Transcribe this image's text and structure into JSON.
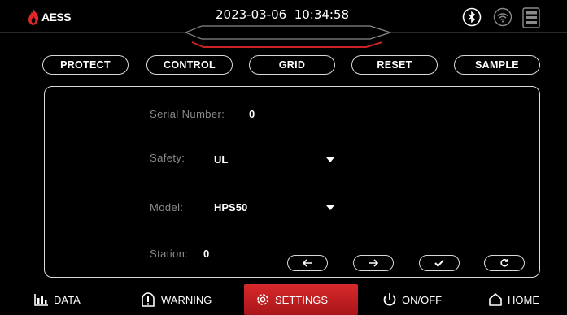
{
  "header": {
    "logo_text": "AESS",
    "datetime": "2023-03-06  10:34:58",
    "status_icons": [
      "bluetooth-icon",
      "wifi-icon",
      "server-icon"
    ]
  },
  "tabs": [
    {
      "label": "PROTECT"
    },
    {
      "label": "CONTROL"
    },
    {
      "label": "GRID"
    },
    {
      "label": "RESET"
    },
    {
      "label": "SAMPLE"
    }
  ],
  "panel": {
    "serial_label": "Serial Number:",
    "serial_value": "0",
    "safety_label": "Safety:",
    "safety_value": "UL",
    "model_label": "Model:",
    "model_value": "HPS50",
    "station_label": "Station:",
    "station_value": "0",
    "action_buttons": [
      "left-arrow-icon",
      "right-arrow-icon",
      "check-icon",
      "refresh-icon"
    ]
  },
  "bottom_nav": [
    {
      "label": "DATA",
      "icon": "bar-chart-icon"
    },
    {
      "label": "WARNING",
      "icon": "warning-icon"
    },
    {
      "label": "SETTINGS",
      "icon": "gear-icon",
      "active": true
    },
    {
      "label": "ON/OFF",
      "icon": "power-icon"
    },
    {
      "label": "HOME",
      "icon": "home-icon"
    }
  ],
  "colors": {
    "accent": "#d8282a",
    "background": "#000000",
    "border": "#d9d9d9",
    "label": "#8a8a8a"
  }
}
